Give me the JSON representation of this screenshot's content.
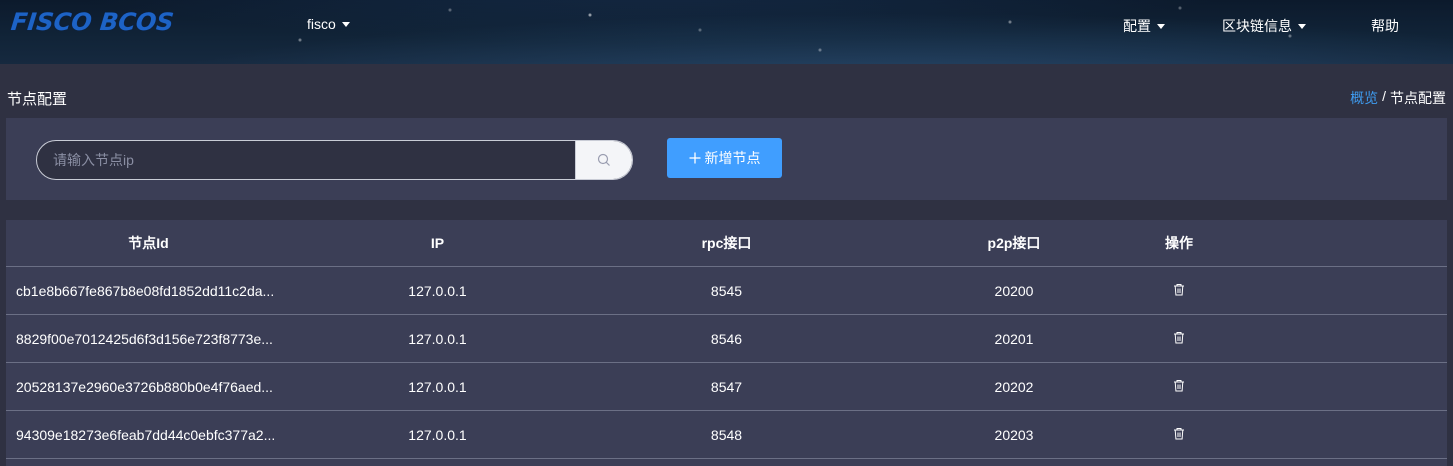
{
  "header": {
    "logo_text": "FISCO BCOS",
    "group_selector": "fisco",
    "nav": {
      "config_label": "配置",
      "chain_info_label": "区块链信息",
      "help_label": "帮助"
    }
  },
  "page": {
    "title": "节点配置",
    "breadcrumb": {
      "home": "概览",
      "separator": "/",
      "current": "节点配置"
    }
  },
  "toolbar": {
    "search_placeholder": "请输入节点ip",
    "search_value": "",
    "add_node_label": "新增节点"
  },
  "table": {
    "columns": {
      "node_id": "节点Id",
      "ip": "IP",
      "rpc_port": "rpc接口",
      "p2p_port": "p2p接口",
      "actions": "操作"
    },
    "rows": [
      {
        "node_id": "cb1e8b667fe867b8e08fd1852dd11c2da...",
        "ip": "127.0.0.1",
        "rpc_port": "8545",
        "p2p_port": "20200"
      },
      {
        "node_id": "8829f00e7012425d6f3d156e723f8773e...",
        "ip": "127.0.0.1",
        "rpc_port": "8546",
        "p2p_port": "20201"
      },
      {
        "node_id": "20528137e2960e3726b880b0e4f76aed...",
        "ip": "127.0.0.1",
        "rpc_port": "8547",
        "p2p_port": "20202"
      },
      {
        "node_id": "94309e18273e6feab7dd44c0ebfc377a2...",
        "ip": "127.0.0.1",
        "rpc_port": "8548",
        "p2p_port": "20203"
      }
    ]
  },
  "colors": {
    "accent": "#409eff",
    "link": "#3e9bef",
    "background": "#2f3142",
    "panel": "#3b3e56",
    "logo": "#1d63c6"
  },
  "icons": {
    "search": "search-icon",
    "add": "plus-icon",
    "delete": "trash-icon",
    "dropdown": "caret-down-icon"
  }
}
